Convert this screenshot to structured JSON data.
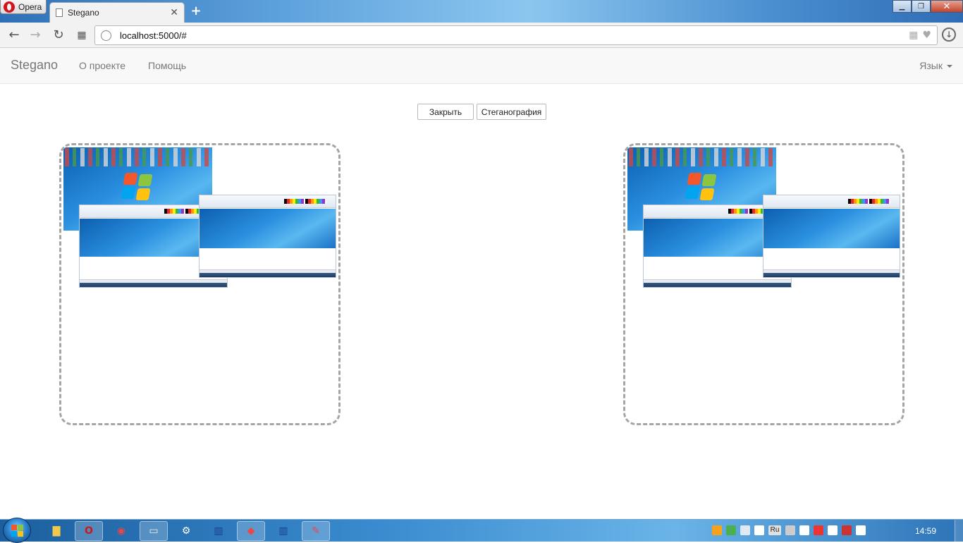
{
  "browser": {
    "menu_label": "Opera",
    "tab_title": "Stegano",
    "url": "localhost:5000/#",
    "new_tab": "+",
    "tab_close": "✕"
  },
  "navbar": {
    "brand": "Stegano",
    "links": [
      "О проекте",
      "Помощь"
    ],
    "language": "Язык"
  },
  "actions": {
    "close_label": "Закрыть",
    "stegano_label": "Стеганография"
  },
  "taskbar": {
    "clock": "14:59",
    "tray_language": "Ru"
  },
  "colors": {
    "navbar_bg": "#f8f8f8",
    "navbar_text": "#777777",
    "dropzone_border": "#a5a5a5"
  }
}
